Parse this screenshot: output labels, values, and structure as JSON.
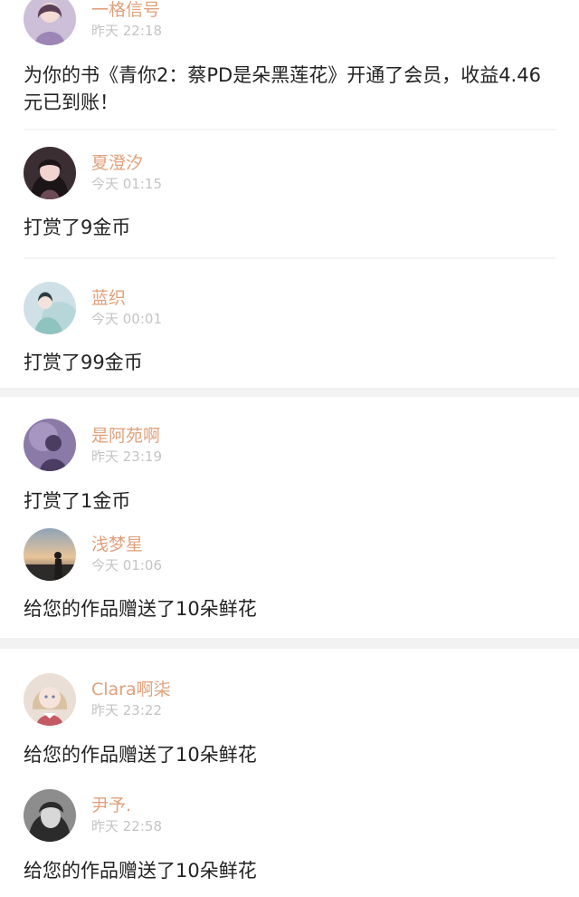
{
  "accent_color": "#e0a17c",
  "entries": [
    {
      "avatar_icon": "girl-lavender-avatar",
      "user": "一格信号",
      "time": "昨天 22:18",
      "message": "为你的书《青你2：蔡PD是朵黑莲花》开通了会员，收益4.46元已到账！"
    },
    {
      "avatar_icon": "girl-dark-hair-avatar",
      "user": "夏澄汐",
      "time": "今天 01:15",
      "message": "打赏了9金币"
    },
    {
      "avatar_icon": "hanfu-girl-avatar",
      "user": "蓝织",
      "time": "今天 00:01",
      "message": "打赏了99金币"
    },
    {
      "avatar_icon": "purple-silhouette-avatar",
      "user": "是阿苑啊",
      "time": "昨天 23:19",
      "message": "打赏了1金币"
    },
    {
      "avatar_icon": "sunset-silhouette-avatar",
      "user": "浅梦星",
      "time": "今天 01:06",
      "message": "给您的作品赠送了10朵鲜花"
    },
    {
      "avatar_icon": "doll-girl-avatar",
      "user": "Clara啊柒",
      "time": "昨天 23:22",
      "message": "给您的作品赠送了10朵鲜花"
    },
    {
      "avatar_icon": "bw-girl-avatar",
      "user": "尹予.",
      "time": "昨天 22:58",
      "message": "给您的作品赠送了10朵鲜花"
    }
  ]
}
